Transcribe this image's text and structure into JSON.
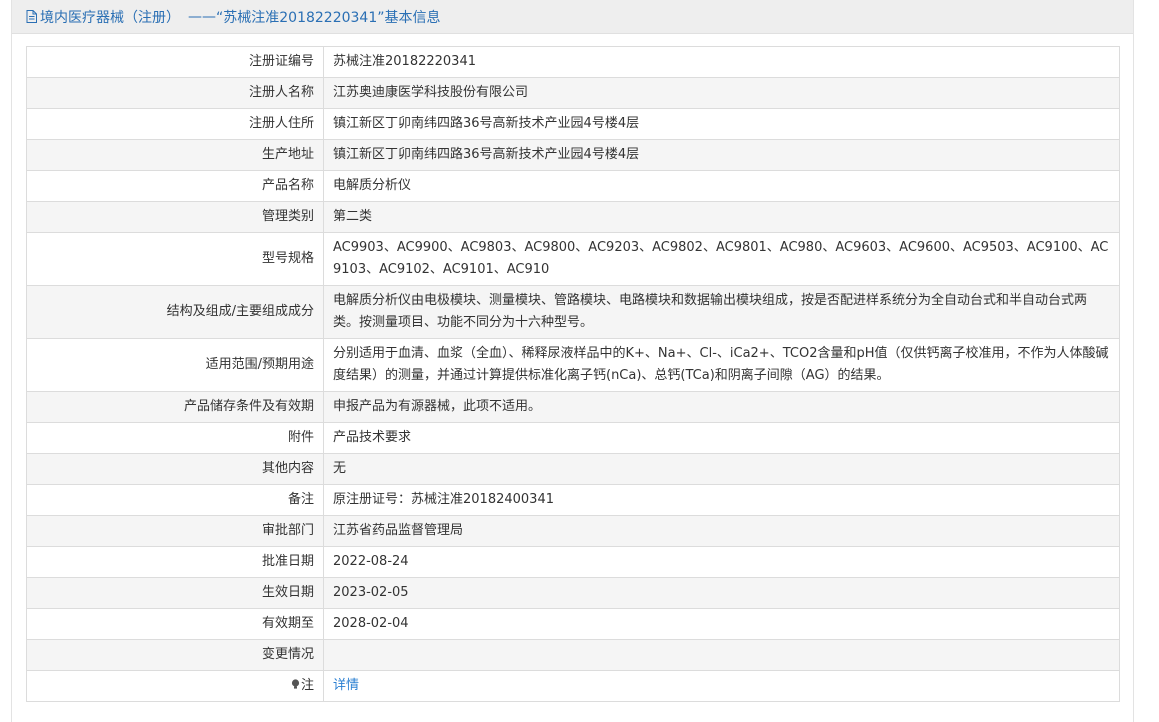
{
  "header": {
    "category": "境内医疗器械（注册）",
    "separator": "——",
    "record_title": "“苏械注准20182220341”基本信息"
  },
  "fields": [
    {
      "label": "注册证编号",
      "value": "苏械注准20182220341"
    },
    {
      "label": "注册人名称",
      "value": "江苏奥迪康医学科技股份有限公司"
    },
    {
      "label": "注册人住所",
      "value": "镇江新区丁卯南纬四路36号高新技术产业园4号楼4层"
    },
    {
      "label": "生产地址",
      "value": "镇江新区丁卯南纬四路36号高新技术产业园4号楼4层"
    },
    {
      "label": "产品名称",
      "value": "电解质分析仪"
    },
    {
      "label": "管理类别",
      "value": "第二类"
    },
    {
      "label": "型号规格",
      "value": "AC9903、AC9900、AC9803、AC9800、AC9203、AC9802、AC9801、AC980、AC9603、AC9600、AC9503、AC9100、AC9103、AC9102、AC9101、AC910"
    },
    {
      "label": "结构及组成/主要组成成分",
      "value": "电解质分析仪由电极模块、测量模块、管路模块、电路模块和数据输出模块组成，按是否配进样系统分为全自动台式和半自动台式两类。按测量项目、功能不同分为十六种型号。"
    },
    {
      "label": "适用范围/预期用途",
      "value": "分别适用于血清、血浆（全血）、稀释尿液样品中的K+、Na+、Cl-、iCa2+、TCO2含量和pH值（仅供钙离子校准用，不作为人体酸碱度结果）的测量，并通过计算提供标准化离子钙(nCa)、总钙(TCa)和阴离子间隙（AG）的结果。"
    },
    {
      "label": "产品储存条件及有效期",
      "value": "申报产品为有源器械，此项不适用。"
    },
    {
      "label": "附件",
      "value": "产品技术要求"
    },
    {
      "label": "其他内容",
      "value": "无"
    },
    {
      "label": "备注",
      "value": "原注册证号：苏械注准20182400341"
    },
    {
      "label": "审批部门",
      "value": "江苏省药品监督管理局"
    },
    {
      "label": "批准日期",
      "value": "2022-08-24"
    },
    {
      "label": "生效日期",
      "value": "2023-02-05"
    },
    {
      "label": "有效期至",
      "value": "2028-02-04"
    },
    {
      "label": "变更情况",
      "value": ""
    }
  ],
  "note_row": {
    "label": "注",
    "link_text": "详情",
    "icon": "lightbulb-icon"
  },
  "colors": {
    "title": "#2a6fb4",
    "link": "#2a7fd2",
    "row_alt": "#f5f5f5",
    "border": "#dcdcdc"
  }
}
